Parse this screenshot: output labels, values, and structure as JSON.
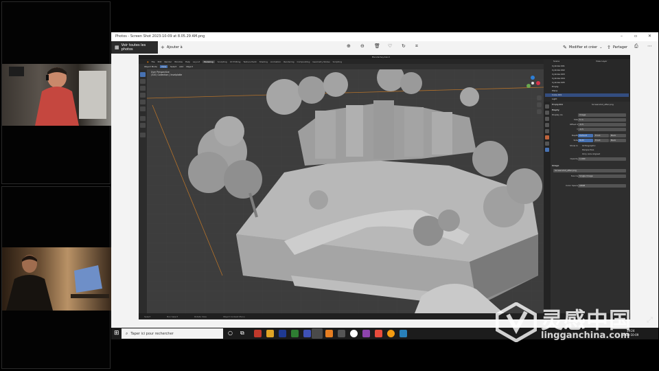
{
  "photos": {
    "title": "Photos - Screen Shot 2023-10-09 at 8.05.29 AM.png",
    "see_all": "Voir toutes les photos",
    "add_to": "Ajouter à",
    "edit_create": "Modifier et créer",
    "share": "Partager",
    "icons": [
      "zoom-in-icon",
      "zoom-out-icon",
      "delete-icon",
      "favorite-icon",
      "rotate-icon",
      "crop-icon",
      "more-icon"
    ]
  },
  "blender": {
    "file_title": "Blenderbay.blend",
    "menu": [
      "File",
      "Edit",
      "Render",
      "Window",
      "Help"
    ],
    "workspaces": [
      "Layout",
      "Modeling",
      "Sculpting",
      "UV Editing",
      "Texture Paint",
      "Shading",
      "Animation",
      "Rendering",
      "Compositing",
      "Geometry Nodes",
      "Scripting"
    ],
    "active_workspace": "Modeling",
    "header": [
      "Object Mode",
      "View",
      "Select",
      "Add",
      "Object"
    ],
    "active_header": "View",
    "viewport_label_1": "User Perspective",
    "viewport_label_2": "(320) Collection | Inselplatte",
    "status": [
      "Select",
      "Box Select",
      "Rotate View",
      "Object Context Menu"
    ],
    "outliner": {
      "search": "Scene",
      "view_layer": "View Layer",
      "rows": [
        "Cylinder.001",
        "Cylinder.002",
        "Cylinder.003",
        "Cylinder.004",
        "Cylinder.005",
        "Empty",
        "Plane",
        "Cube.001",
        "Light"
      ]
    },
    "properties": {
      "object_name": "Empty.004",
      "image_name": "Screenshot_after.png",
      "section": "Empty",
      "display_as": "Display As",
      "display_value": "Image",
      "size_label": "Size",
      "size_value": "5 m",
      "offset_x_label": "Offset X",
      "offset_x_value": "-0.5",
      "offset_y_label": "Y",
      "offset_y_value": "-0.5",
      "depth_label": "Depth",
      "depth_opts": [
        "Default",
        "Front",
        "Back"
      ],
      "side_label": "Side",
      "side_opts": [
        "Both",
        "Front",
        "Back"
      ],
      "show_in_label": "Show In",
      "show_opts": [
        "Orthographic",
        "Perspective",
        "Only Axis Aligned"
      ],
      "opacity_label": "Opacity",
      "opacity_value": "1.000",
      "image_section": "Image",
      "source_label": "Source",
      "source_value": "Single Image",
      "colorspace_label": "Color Space",
      "colorspace_value": "sRGB"
    }
  },
  "taskbar": {
    "search_placeholder": "Taper ici pour rechercher",
    "time": "19:24",
    "date": "2023-10-09"
  },
  "watermark": {
    "cn": "灵感中国",
    "url": "lingganchina.com"
  }
}
